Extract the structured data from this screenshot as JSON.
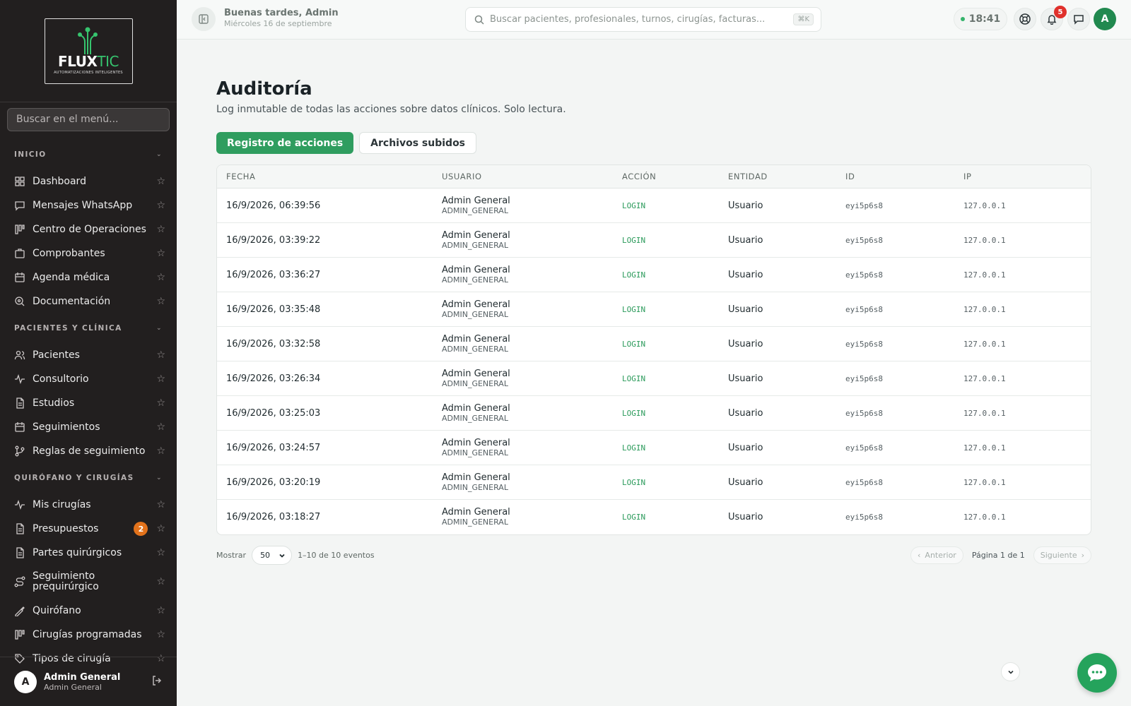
{
  "brand": {
    "name_a": "FLUX",
    "name_b": "TIC",
    "tagline": "AUTOMATIZACIONES INTELIGENTES"
  },
  "sidebar": {
    "search_placeholder": "Buscar en el menú...",
    "sections": [
      {
        "title": "INICIO",
        "items": [
          {
            "label": "Dashboard",
            "icon": "grid-icon"
          },
          {
            "label": "Mensajes WhatsApp",
            "icon": "message-icon"
          },
          {
            "label": "Centro de Operaciones",
            "icon": "kanban-icon"
          },
          {
            "label": "Comprobantes",
            "icon": "briefcase-icon"
          },
          {
            "label": "Agenda médica",
            "icon": "calendar-icon"
          },
          {
            "label": "Documentación",
            "icon": "search-doc-icon"
          }
        ]
      },
      {
        "title": "PACIENTES Y CLÍNICA",
        "items": [
          {
            "label": "Pacientes",
            "icon": "users-icon"
          },
          {
            "label": "Consultorio",
            "icon": "activity-icon"
          },
          {
            "label": "Estudios",
            "icon": "file-icon"
          },
          {
            "label": "Seguimientos",
            "icon": "calendar-icon"
          },
          {
            "label": "Reglas de seguimiento",
            "icon": "git-branch-icon"
          }
        ]
      },
      {
        "title": "QUIRÓFANO Y CIRUGÍAS",
        "items": [
          {
            "label": "Mis cirugías",
            "icon": "activity-icon"
          },
          {
            "label": "Presupuestos",
            "icon": "file-icon",
            "badge": "2"
          },
          {
            "label": "Partes quirúrgicos",
            "icon": "file-icon"
          },
          {
            "label": "Seguimiento prequirúrgico",
            "icon": "route-icon"
          },
          {
            "label": "Quirófano",
            "icon": "scalpel-icon"
          },
          {
            "label": "Cirugías programadas",
            "icon": "kanban-icon"
          },
          {
            "label": "Tipos de cirugía",
            "icon": "tag-icon"
          }
        ]
      }
    ],
    "user": {
      "initial": "A",
      "name": "Admin General",
      "role": "Admin General"
    }
  },
  "topbar": {
    "greeting": "Buenas tardes, Admin",
    "date": "Miércoles 16 de septiembre",
    "search_placeholder": "Buscar pacientes, profesionales, turnos, cirugías, facturas...",
    "shortcut": "⌘K",
    "time": "18:41",
    "notifications": "5",
    "avatar": "A"
  },
  "main": {
    "title": "Auditoría",
    "subtitle": "Log inmutable de todas las acciones sobre datos clínicos. Solo lectura.",
    "tabs": [
      "Registro de acciones",
      "Archivos subidos"
    ],
    "columns": [
      "FECHA",
      "USUARIO",
      "ACCIÓN",
      "ENTIDAD",
      "ID",
      "IP"
    ],
    "rows": [
      {
        "fecha": "16/9/2026, 06:39:56",
        "usuario": "Admin General",
        "rol": "ADMIN_GENERAL",
        "accion": "LOGIN",
        "entidad": "Usuario",
        "id": "eyi5p6s8",
        "ip": "127.0.0.1"
      },
      {
        "fecha": "16/9/2026, 03:39:22",
        "usuario": "Admin General",
        "rol": "ADMIN_GENERAL",
        "accion": "LOGIN",
        "entidad": "Usuario",
        "id": "eyi5p6s8",
        "ip": "127.0.0.1"
      },
      {
        "fecha": "16/9/2026, 03:36:27",
        "usuario": "Admin General",
        "rol": "ADMIN_GENERAL",
        "accion": "LOGIN",
        "entidad": "Usuario",
        "id": "eyi5p6s8",
        "ip": "127.0.0.1"
      },
      {
        "fecha": "16/9/2026, 03:35:48",
        "usuario": "Admin General",
        "rol": "ADMIN_GENERAL",
        "accion": "LOGIN",
        "entidad": "Usuario",
        "id": "eyi5p6s8",
        "ip": "127.0.0.1"
      },
      {
        "fecha": "16/9/2026, 03:32:58",
        "usuario": "Admin General",
        "rol": "ADMIN_GENERAL",
        "accion": "LOGIN",
        "entidad": "Usuario",
        "id": "eyi5p6s8",
        "ip": "127.0.0.1"
      },
      {
        "fecha": "16/9/2026, 03:26:34",
        "usuario": "Admin General",
        "rol": "ADMIN_GENERAL",
        "accion": "LOGIN",
        "entidad": "Usuario",
        "id": "eyi5p6s8",
        "ip": "127.0.0.1"
      },
      {
        "fecha": "16/9/2026, 03:25:03",
        "usuario": "Admin General",
        "rol": "ADMIN_GENERAL",
        "accion": "LOGIN",
        "entidad": "Usuario",
        "id": "eyi5p6s8",
        "ip": "127.0.0.1"
      },
      {
        "fecha": "16/9/2026, 03:24:57",
        "usuario": "Admin General",
        "rol": "ADMIN_GENERAL",
        "accion": "LOGIN",
        "entidad": "Usuario",
        "id": "eyi5p6s8",
        "ip": "127.0.0.1"
      },
      {
        "fecha": "16/9/2026, 03:20:19",
        "usuario": "Admin General",
        "rol": "ADMIN_GENERAL",
        "accion": "LOGIN",
        "entidad": "Usuario",
        "id": "eyi5p6s8",
        "ip": "127.0.0.1"
      },
      {
        "fecha": "16/9/2026, 03:18:27",
        "usuario": "Admin General",
        "rol": "ADMIN_GENERAL",
        "accion": "LOGIN",
        "entidad": "Usuario",
        "id": "eyi5p6s8",
        "ip": "127.0.0.1"
      }
    ],
    "pagination": {
      "show_label": "Mostrar",
      "page_size": "50",
      "range": "1–10 de 10 eventos",
      "prev": "Anterior",
      "page_info": "Página 1 de 1",
      "next": "Siguiente"
    }
  },
  "colors": {
    "accent": "#2f9d5f",
    "sidebar_bg": "#221f1f",
    "badge": "#e2721b",
    "notif": "#e0312c"
  }
}
